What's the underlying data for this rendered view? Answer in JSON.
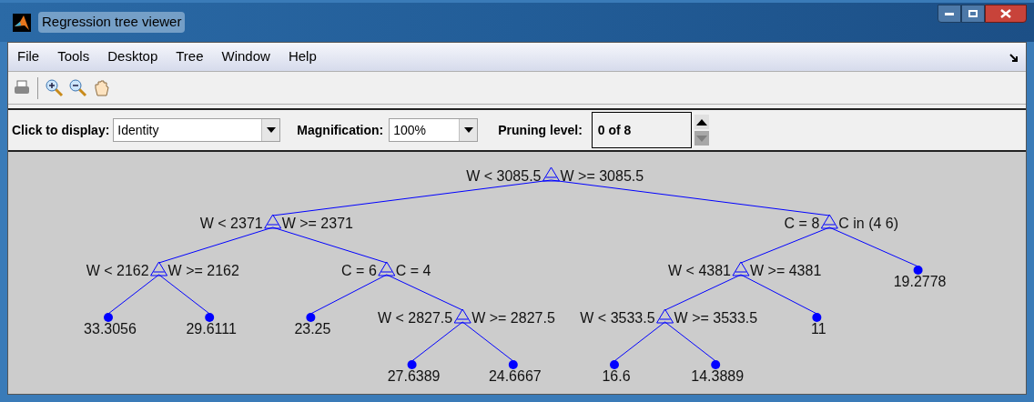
{
  "window": {
    "title": "Regression tree viewer"
  },
  "menu": [
    "File",
    "Tools",
    "Desktop",
    "Tree",
    "Window",
    "Help"
  ],
  "controls": {
    "display_label": "Click to display:",
    "display_value": "Identity",
    "magnification_label": "Magnification:",
    "magnification_value": "100%",
    "pruning_label": "Pruning level:",
    "pruning_value": "0 of 8"
  },
  "tree": {
    "kind": "split",
    "left_label": "W < 3085.5",
    "right_label": "W >= 3085.5",
    "children": [
      {
        "kind": "split",
        "left_label": "W < 2371",
        "right_label": "W >= 2371",
        "children": [
          {
            "kind": "split",
            "left_label": "W < 2162",
            "right_label": "W >= 2162",
            "children": [
              {
                "kind": "leaf",
                "value": "33.3056"
              },
              {
                "kind": "leaf",
                "value": "29.6111"
              }
            ]
          },
          {
            "kind": "split",
            "left_label": "C = 6",
            "right_label": "C = 4",
            "children": [
              {
                "kind": "leaf",
                "value": "23.25"
              },
              {
                "kind": "split",
                "left_label": "W < 2827.5",
                "right_label": "W >= 2827.5",
                "children": [
                  {
                    "kind": "leaf",
                    "value": "27.6389"
                  },
                  {
                    "kind": "leaf",
                    "value": "24.6667"
                  }
                ]
              }
            ]
          }
        ]
      },
      {
        "kind": "split",
        "left_label": "C = 8",
        "right_label": "C in (4 6)",
        "children": [
          {
            "kind": "split",
            "left_label": "W < 4381",
            "right_label": "W >= 4381",
            "children": [
              {
                "kind": "split",
                "left_label": "W < 3533.5",
                "right_label": "W >= 3533.5",
                "children": [
                  {
                    "kind": "leaf",
                    "value": "16.6"
                  },
                  {
                    "kind": "leaf",
                    "value": "14.3889"
                  }
                ]
              },
              {
                "kind": "leaf",
                "value": "11"
              }
            ]
          },
          {
            "kind": "leaf",
            "value": "19.2778"
          }
        ]
      }
    ]
  }
}
